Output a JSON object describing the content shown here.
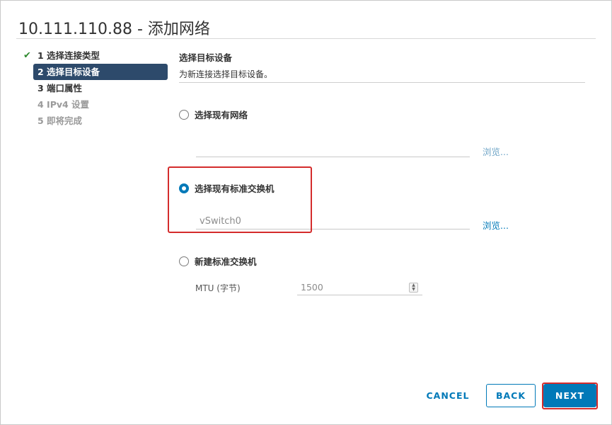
{
  "window": {
    "title": "10.111.110.88 - 添加网络"
  },
  "steps": [
    {
      "label": "1 选择连接类型",
      "state": "completed"
    },
    {
      "label": "2 选择目标设备",
      "state": "active"
    },
    {
      "label": "3 端口属性",
      "state": "normal"
    },
    {
      "label": "4 IPv4 设置",
      "state": "disabled"
    },
    {
      "label": "5 即将完成",
      "state": "disabled"
    }
  ],
  "section": {
    "title": "选择目标设备",
    "subtitle": "为新连接选择目标设备。"
  },
  "options": {
    "existing_network": {
      "label": "选择现有网络",
      "value": "",
      "browse": "浏览..."
    },
    "existing_switch": {
      "label": "选择现有标准交换机",
      "value": "vSwitch0",
      "browse": "浏览..."
    },
    "new_switch": {
      "label": "新建标准交换机",
      "mtu_label": "MTU (字节)",
      "mtu_value": "1500"
    }
  },
  "selected_option": "existing_switch",
  "buttons": {
    "cancel": "CANCEL",
    "back": "BACK",
    "next": "NEXT"
  },
  "icons": {
    "step_done": "checkmark-icon",
    "mtu_spinner": "spinner-icon"
  },
  "colors": {
    "accent": "#0079b8",
    "active_step": "#2d4a6b",
    "annotation": "#d42c2c",
    "check": "#2f8a2f"
  }
}
